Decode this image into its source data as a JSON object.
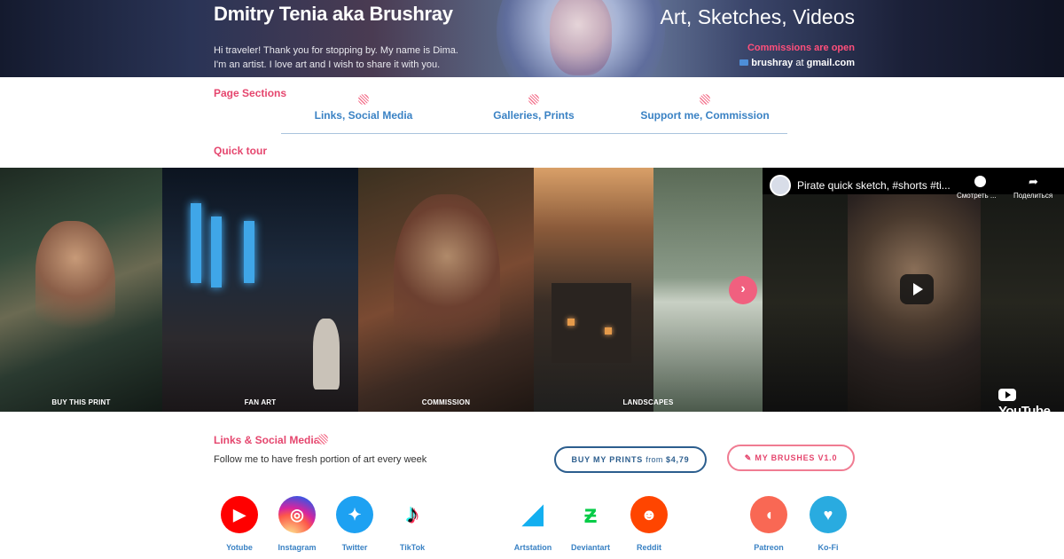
{
  "header": {
    "title": "Dmitry Tenia aka Brushray",
    "intro_line1": "Hi traveler! Thank you for stopping by. My name is Dima.",
    "intro_line2": "I'm an artist. I love art and I wish to share it with you.",
    "tagline": "Art, Sketches, Videos",
    "commissions": "Commissions are open",
    "email_user": "brushray",
    "email_at": " at ",
    "email_domain": "gmail.com"
  },
  "sections": {
    "label": "Page Sections",
    "links": [
      "Links, Social Media",
      "Galleries, Prints",
      "Support me, Commission"
    ]
  },
  "quick_tour": {
    "label": "Quick tour",
    "panels": [
      "BUY THIS PRINT",
      "FAN ART",
      "COMMISSION",
      "LANDSCAPES"
    ],
    "next_icon": "chevron-right-icon"
  },
  "video": {
    "title": "Pirate quick sketch, #shorts #ti...",
    "watch_later": "Смотреть ...",
    "share": "Поделиться",
    "brand": "YouTube"
  },
  "links_section": {
    "label": "Links & Social Media",
    "follow_text": "Follow me to have fresh portion of art every week",
    "prints_button": "BUY MY PRINTS",
    "prints_from": "from",
    "prints_price": "$4,79",
    "brushes_button": "MY BRUSHES V1.0"
  },
  "social": [
    {
      "label": "Yotube",
      "icon": "youtube-icon",
      "color": "#ff0000"
    },
    {
      "label": "Instagram",
      "icon": "instagram-icon",
      "color": "#c13584"
    },
    {
      "label": "Twitter",
      "icon": "twitter-icon",
      "color": "#1da1f2"
    },
    {
      "label": "TikTok",
      "icon": "tiktok-icon",
      "color": "#000000"
    },
    {
      "label": "Artstation",
      "icon": "artstation-icon",
      "color": "#13aff0"
    },
    {
      "label": "Deviantart",
      "icon": "deviantart-icon",
      "color": "#05cc47"
    },
    {
      "label": "Reddit",
      "icon": "reddit-icon",
      "color": "#ff4500"
    },
    {
      "label": "Patreon",
      "icon": "patreon-icon",
      "color": "#f96854"
    },
    {
      "label": "Ko-Fi",
      "icon": "kofi-icon",
      "color": "#29abe0"
    }
  ]
}
